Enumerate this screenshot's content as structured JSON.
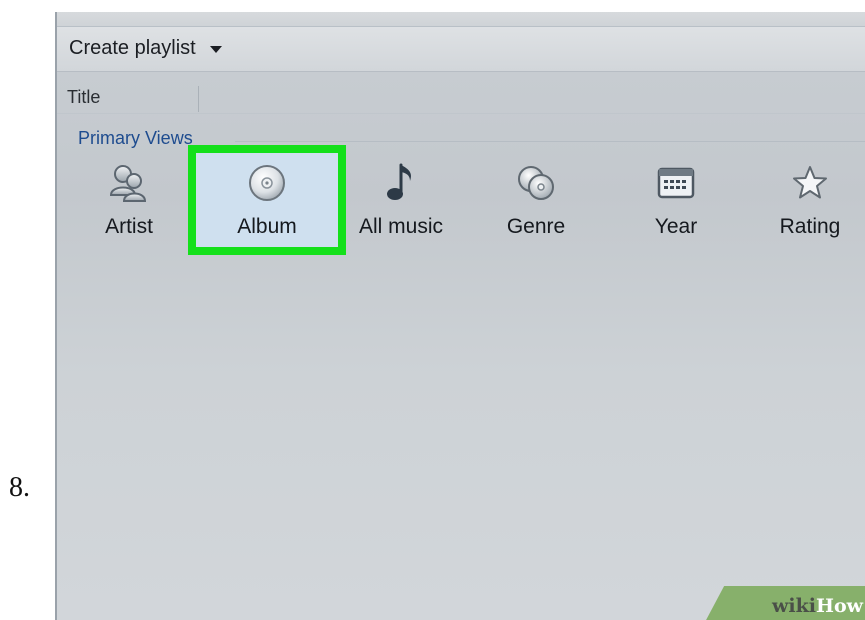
{
  "step_number": "8.",
  "toolbar": {
    "create_playlist_label": "Create playlist"
  },
  "columns": {
    "title_label": "Title"
  },
  "group": {
    "label": "Primary Views"
  },
  "views": [
    {
      "label": "Artist",
      "icon": "artist-icon"
    },
    {
      "label": "Album",
      "icon": "album-disc-icon",
      "selected": true
    },
    {
      "label": "All music",
      "icon": "music-note-icon"
    },
    {
      "label": "Genre",
      "icon": "genre-discs-icon"
    },
    {
      "label": "Year",
      "icon": "calendar-icon"
    },
    {
      "label": "Rating",
      "icon": "star-icon"
    }
  ],
  "colors": {
    "highlight_outline": "#14e01b",
    "group_label": "#1e4c8f",
    "selected_fill": "#cfe0ef"
  },
  "watermark": {
    "prefix": "wiki",
    "suffix": "How"
  }
}
